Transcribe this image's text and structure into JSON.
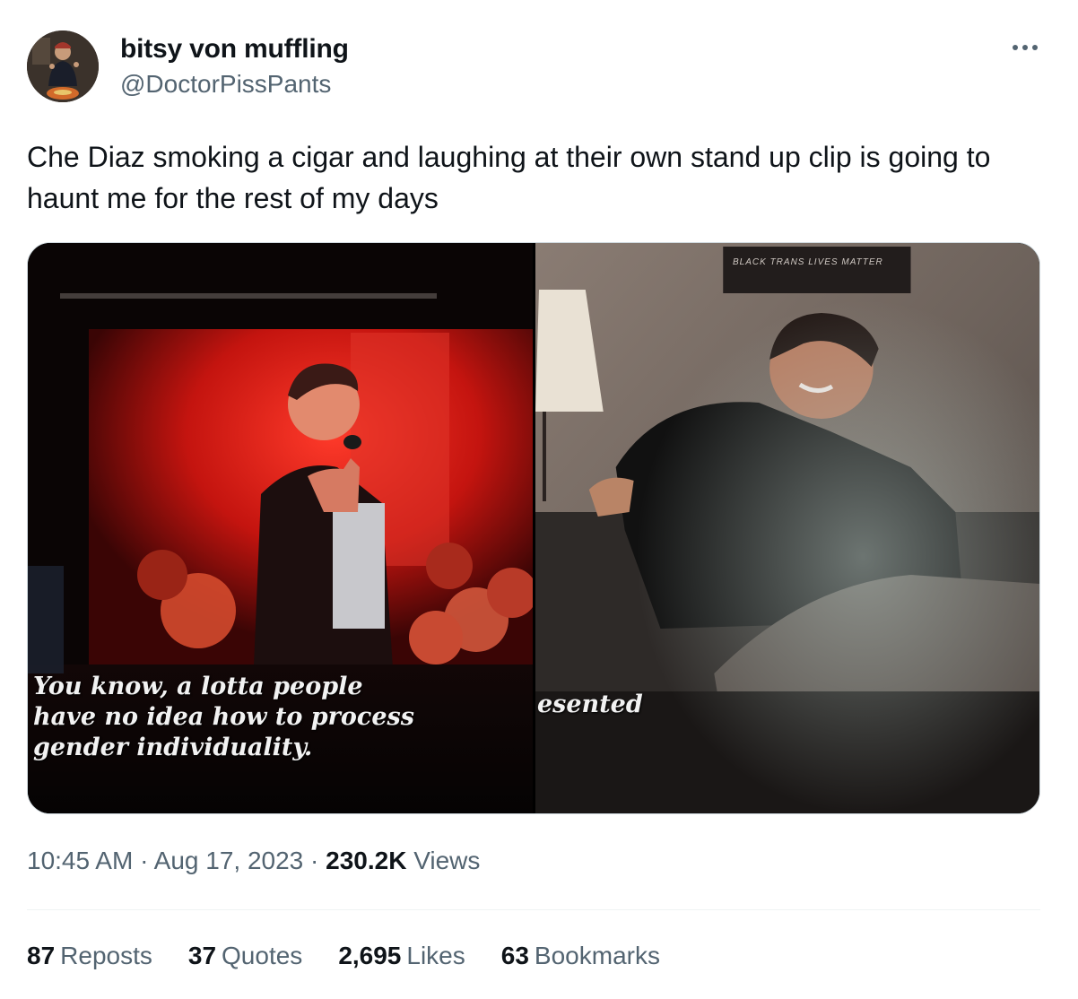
{
  "author": {
    "display_name": "bitsy von muffling",
    "handle": "@DoctorPissPants"
  },
  "tweet": {
    "text": "Che Diaz smoking a cigar and laughing at their own stand up clip is going to haunt me for the rest of my days"
  },
  "media": {
    "left_caption_lines": [
      "You know, a lotta people",
      "have no idea how to process",
      "gender individuality."
    ],
    "right_caption": "esented",
    "right_sign_text": "BLACK TRANS LIVES MATTER"
  },
  "meta": {
    "time": "10:45 AM",
    "separator": "·",
    "date": "Aug 17, 2023",
    "views_count": "230.2K",
    "views_label": "Views"
  },
  "stats": {
    "reposts_count": "87",
    "reposts_label": "Reposts",
    "quotes_count": "37",
    "quotes_label": "Quotes",
    "likes_count": "2,695",
    "likes_label": "Likes",
    "bookmarks_count": "63",
    "bookmarks_label": "Bookmarks"
  },
  "icons": {
    "more": "more-horizontal-icon"
  }
}
